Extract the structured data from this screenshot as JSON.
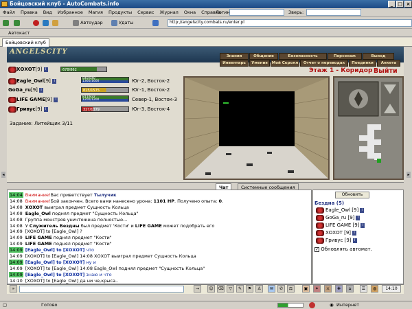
{
  "window": {
    "title": "Бойцовский клуб - AutoCombats.info"
  },
  "menubar": {
    "items": [
      "Файл",
      "Правка",
      "Вид",
      "Избранное",
      "Магия",
      "Продукты",
      "Сервис",
      "Журнал",
      "Окна",
      "Справка"
    ],
    "login_label": "Логин:",
    "zver_label": "Зверь:"
  },
  "toolbar": {
    "autoudar": "Автоудар",
    "udaty": "Удаты",
    "address": "http://angelscity.combats.ru/enter.pl"
  },
  "links": {
    "avtokast": "Автокаст"
  },
  "tabs": {
    "main": "Бойцовский клуб"
  },
  "game": {
    "logo": "ANGELSCITY",
    "nav_top": [
      "Знания",
      "Общение",
      "Безопасность",
      "Персонаж",
      "Выход"
    ],
    "nav_bottom": [
      "Инвентарь",
      "Умения",
      "Мой Скролл",
      "Отчет о переводах",
      "Поединки",
      "Анкета"
    ],
    "floor": "Этаж 1 - Коридор",
    "exit": "Выйти",
    "task": "Задание: Литейщик 3/11",
    "players": [
      {
        "name": "ХОХОТ",
        "level": "[9]",
        "hp": "678/862",
        "mana": "",
        "loc": ""
      },
      {
        "name": "Eagle_Owl",
        "level": "[9]",
        "hp": "840/840",
        "mana": "1360/1600",
        "loc": "Юг-2, Восток-2"
      },
      {
        "name": "GoGa_ru",
        "level": "[9]",
        "hp": "815/1575",
        "mana": "",
        "loc": "Юг-1, Восток-2"
      },
      {
        "name": "LIFE GAME",
        "level": "[9]",
        "hp": "811/832",
        "mana": "1200/1200",
        "loc": "Север-1, Восток-3"
      },
      {
        "name": "Гривус",
        "level": "[9]",
        "hp": "327/1379",
        "mana": "",
        "loc": "Юг-3, Восток-4"
      }
    ]
  },
  "chat": {
    "tab_chat": "Чат",
    "tab_system": "Системные сообщения",
    "lines": [
      {
        "ts": "14:04",
        "hl": true,
        "parts": [
          [
            "red",
            "Внимание!"
          ],
          [
            "",
            "Вас приветствует "
          ],
          [
            "navyb",
            "Тылучик"
          ]
        ]
      },
      {
        "ts": "14:08",
        "hl": false,
        "parts": [
          [
            "red",
            "Внимание!"
          ],
          [
            "",
            "Бой закончен. Всего вами нанесено урона: "
          ],
          [
            "b",
            "1101 HP"
          ],
          [
            "",
            ". Получено опыта: "
          ],
          [
            "b",
            "0"
          ],
          [
            "",
            "."
          ]
        ]
      },
      {
        "ts": "14:08",
        "hl": false,
        "parts": [
          [
            "b",
            "ХОХОТ"
          ],
          [
            "",
            " выиграл предмет Сущность Кольца"
          ]
        ]
      },
      {
        "ts": "14:08",
        "hl": false,
        "parts": [
          [
            "b",
            "Eagle_Owl"
          ],
          [
            "",
            " поднял предмет \"Сущность Кольца\""
          ]
        ]
      },
      {
        "ts": "14:08",
        "hl": false,
        "parts": [
          [
            "",
            "Группа монстров уничтожена полностью..."
          ]
        ]
      },
      {
        "ts": "14:08",
        "hl": false,
        "parts": [
          [
            "",
            "У "
          ],
          [
            "b",
            "Служитель Бездны"
          ],
          [
            "",
            " был предмет 'Кости' и "
          ],
          [
            "b",
            "LIFE GAME"
          ],
          [
            "",
            " может подобрать его"
          ]
        ]
      },
      {
        "ts": "14:09",
        "hl": false,
        "parts": [
          [
            "",
            "[ХОХОТ] to [Eagle_Owl] ?"
          ]
        ]
      },
      {
        "ts": "14:09",
        "hl": false,
        "parts": [
          [
            "b",
            "LIFE GAME"
          ],
          [
            "",
            " поднял предмет \"Кости\""
          ]
        ]
      },
      {
        "ts": "14:09",
        "hl": false,
        "parts": [
          [
            "b",
            "LIFE GAME"
          ],
          [
            "",
            " поднял предмет \"Кости\""
          ]
        ]
      },
      {
        "ts": "14:09",
        "hl": true,
        "parts": [
          [
            "blueb",
            "[Eagle_Owl] to [ХОХОТ]"
          ],
          [
            "blue",
            " что"
          ]
        ]
      },
      {
        "ts": "14:09",
        "hl": false,
        "parts": [
          [
            "",
            "[ХОХОТ] to [Eagle_Owl] 14:08 ХОХОТ выиграл предмет Сущность Кольца"
          ]
        ]
      },
      {
        "ts": "14:09",
        "hl": true,
        "parts": [
          [
            "blueb",
            "[Eagle_Owl] to [ХОХОТ]"
          ],
          [
            "blue",
            " ну и"
          ]
        ]
      },
      {
        "ts": "14:09",
        "hl": false,
        "parts": [
          [
            "",
            "[ХОХОТ] to [Eagle_Owl] 14:08 Eagle_Owl поднял предмет \"Сущность Кольца\""
          ]
        ]
      },
      {
        "ts": "14:09",
        "hl": true,
        "parts": [
          [
            "blueb",
            "[Eagle_Owl] to [ХОХОТ]"
          ],
          [
            "blue",
            " знаю и что"
          ]
        ]
      },
      {
        "ts": "14:10",
        "hl": false,
        "parts": [
          [
            "",
            "[ХОХОТ] to [Eagle_Owl] да ни че,крыса.."
          ]
        ]
      }
    ]
  },
  "right": {
    "refresh": "Обновить",
    "title": "Бездна (5)",
    "members": [
      "Eagle_Owl [9]",
      "GoGa_ru [9]",
      "LIFE GAME [9]",
      "ХОХОТ [9]",
      "Гривус [9]"
    ],
    "auto": "Обновлять автомат."
  },
  "status": {
    "ready": "Готово",
    "zone": "Интернет",
    "time": "14:10"
  }
}
